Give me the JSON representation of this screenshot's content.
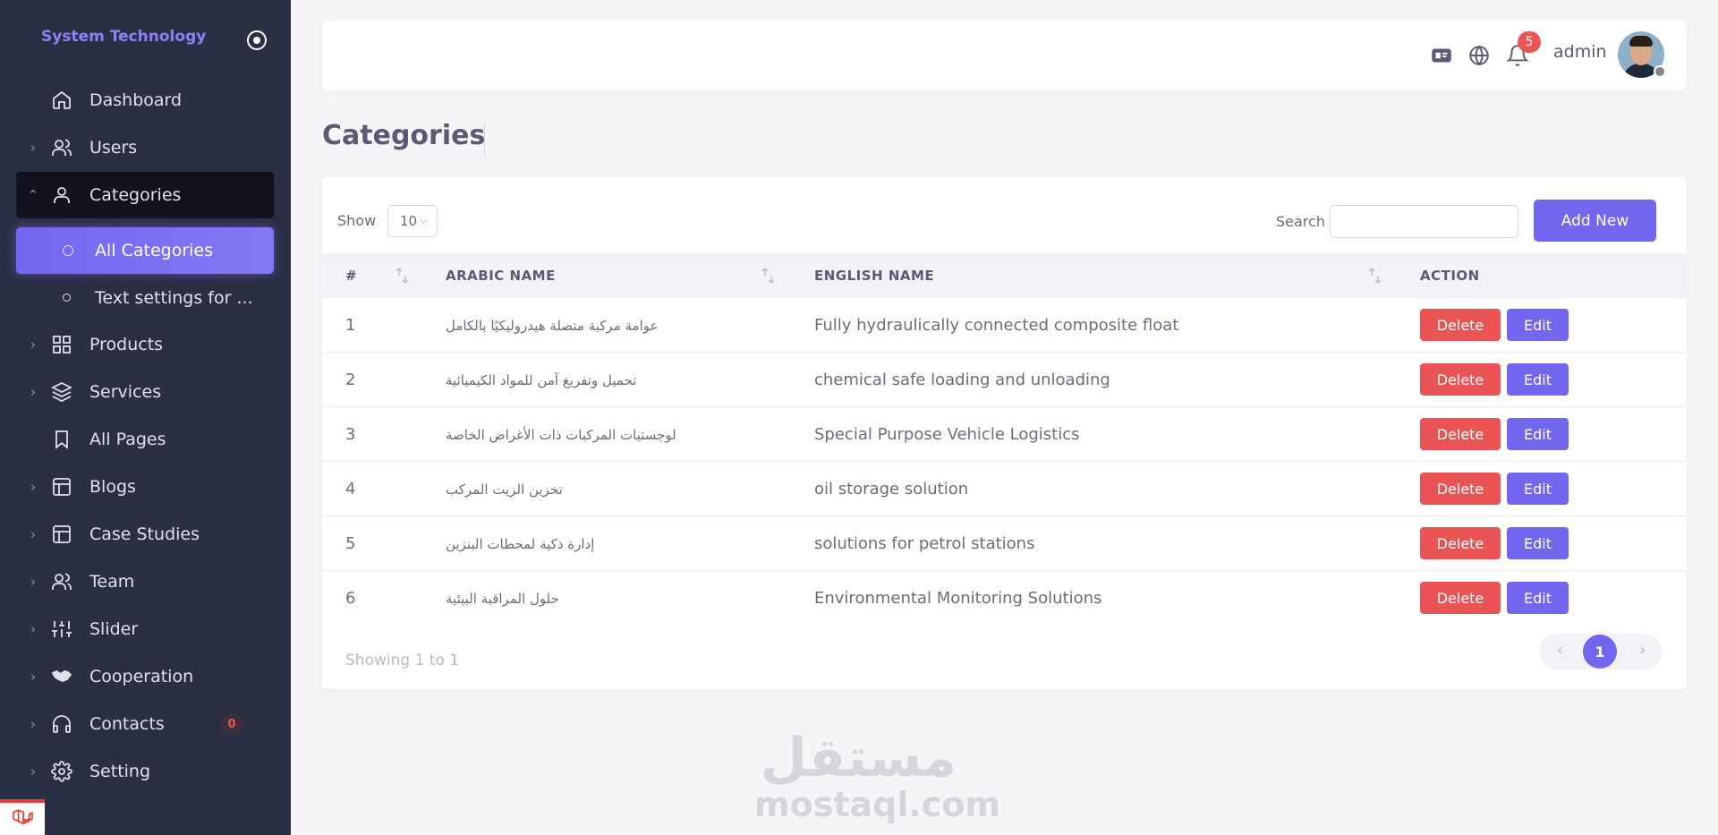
{
  "sidebar": {
    "brand": "System Technology",
    "items": [
      {
        "label": "Dashboard",
        "icon": "home-icon",
        "chevron": ""
      },
      {
        "label": "Users",
        "icon": "users-icon",
        "chevron": "›"
      },
      {
        "label": "Categories",
        "icon": "user-icon",
        "chevron": "⌃"
      },
      {
        "label": "Products",
        "icon": "grid-icon",
        "chevron": "›"
      },
      {
        "label": "Services",
        "icon": "layers-icon",
        "chevron": "›"
      },
      {
        "label": "All Pages",
        "icon": "bookmark-icon",
        "chevron": ""
      },
      {
        "label": "Blogs",
        "icon": "layout-icon",
        "chevron": "›"
      },
      {
        "label": "Case Studies",
        "icon": "layout-icon",
        "chevron": "›"
      },
      {
        "label": "Team",
        "icon": "users-icon",
        "chevron": "›"
      },
      {
        "label": "Slider",
        "icon": "sliders-icon",
        "chevron": "›"
      },
      {
        "label": "Cooperation",
        "icon": "handshake-icon",
        "chevron": "›"
      },
      {
        "label": "Contacts",
        "icon": "headphones-icon",
        "chevron": "›",
        "badge": "0"
      },
      {
        "label": "Setting",
        "icon": "gear-icon",
        "chevron": "›"
      }
    ],
    "subitems": [
      {
        "label": "All Categories"
      },
      {
        "label": "Text settings for ..."
      }
    ]
  },
  "topbar": {
    "notifications": "5",
    "user": "admin"
  },
  "page": {
    "title": "Categories"
  },
  "table": {
    "show_label": "Show",
    "page_size": "10",
    "search_label": "Search",
    "search_value": "",
    "add_label": "Add New",
    "columns": [
      "#",
      "ARABIC NAME",
      "ENGLISH NAME",
      "ACTION"
    ],
    "rows": [
      {
        "id": "1",
        "arabic": "عوامة مركبة متصلة هيدروليكيًا بالكامل",
        "english": "Fully hydraulically connected composite float"
      },
      {
        "id": "2",
        "arabic": "تحميل وتفريغ آمن للمواد الكيميائية",
        "english": "chemical safe loading and unloading"
      },
      {
        "id": "3",
        "arabic": "لوجستيات المركبات ذات الأغراض الخاصة",
        "english": "Special Purpose Vehicle Logistics"
      },
      {
        "id": "4",
        "arabic": "تخزين الزيت المركب",
        "english": "oil storage solution"
      },
      {
        "id": "5",
        "arabic": "إدارة ذكية لمحطات البنزين",
        "english": "solutions for petrol stations"
      },
      {
        "id": "6",
        "arabic": "حلول المراقبة البيئية",
        "english": "Environmental Monitoring Solutions"
      }
    ],
    "delete_label": "Delete",
    "edit_label": "Edit",
    "footer": "Showing 1 to 1",
    "current_page": "1"
  },
  "watermark": {
    "arabic": "مستقل",
    "domain": "mostaql.com"
  },
  "colors": {
    "sidebar_bg": "#2b2f44",
    "accent": "#7367f0",
    "danger": "#ea5455"
  }
}
